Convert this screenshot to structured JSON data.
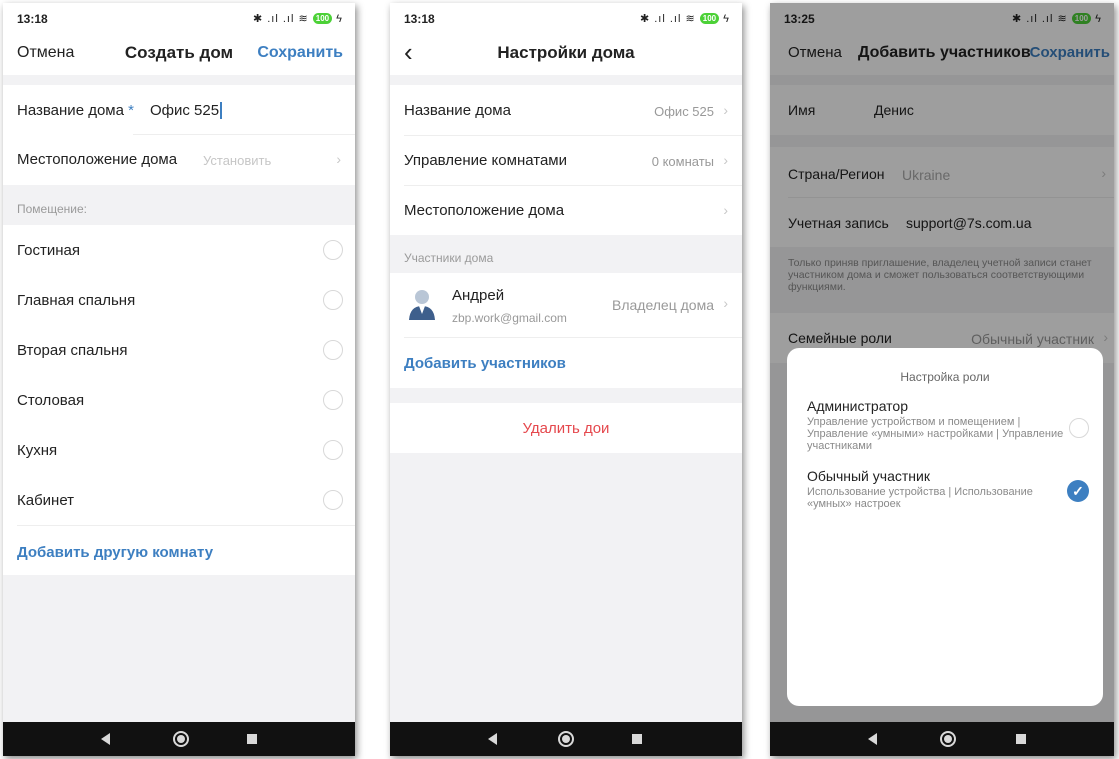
{
  "screen1": {
    "status": {
      "time": "13:18",
      "battery": "100"
    },
    "header": {
      "cancel": "Отмена",
      "title": "Создать дом",
      "save": "Сохранить"
    },
    "name_label": "Название дома",
    "required_mark": "*",
    "name_value": "Офис 525",
    "location_label": "Местоположение дома",
    "location_value": "Установить",
    "rooms_section": "Помещение:",
    "rooms": [
      "Гостиная",
      "Главная спальня",
      "Вторая спальня",
      "Столовая",
      "Кухня",
      "Кабинет"
    ],
    "add_room": "Добавить другую комнату"
  },
  "screen2": {
    "status": {
      "time": "13:18",
      "battery": "100"
    },
    "header": {
      "title": "Настройки дома"
    },
    "name_label": "Название дома",
    "name_value": "Офис 525",
    "rooms_label": "Управление комнатами",
    "rooms_value": "0 комнаты",
    "location_label": "Местоположение дома",
    "members_section": "Участники дома",
    "member": {
      "name": "Андрей",
      "email": "zbp.work@gmail.com",
      "role": "Владелец дома"
    },
    "add_members": "Добавить участников",
    "delete": "Удалить дои"
  },
  "screen3": {
    "status": {
      "time": "13:25",
      "battery": "100"
    },
    "header": {
      "cancel": "Отмена",
      "title": "Добавить участников",
      "save": "Сохранить"
    },
    "name_label": "Имя",
    "name_value": "Денис",
    "country_label": "Страна/Регион",
    "country_value": "Ukraine",
    "account_label": "Учетная запись",
    "account_value": "support@7s.com.ua",
    "notice": "Только приняв приглашение, владелец учетной записи станет участником дома и сможет пользоваться соответствующими функциями.",
    "roles_label": "Семейные роли",
    "roles_value": "Обычный участник",
    "sheet": {
      "title": "Настройка роли",
      "admin_title": "Администратор",
      "admin_desc": "Управление устройством и помещением | Управление «умными» настройками | Управление участниками",
      "member_title": "Обычный участник",
      "member_desc": "Использование устройства | Использование «умных» настроек",
      "selected": "Обычный участник"
    }
  },
  "colors": {
    "accent": "#3d7fc1",
    "danger": "#e5484d",
    "background": "#f2f2f4"
  }
}
